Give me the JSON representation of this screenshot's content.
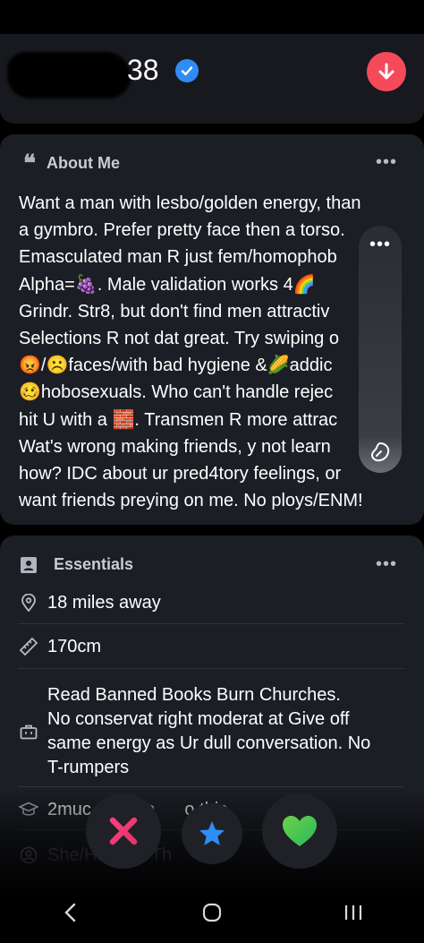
{
  "profile": {
    "age": "38"
  },
  "about": {
    "title": "About Me",
    "more": "•••",
    "lines": [
      "Want a man with lesbo/golden energy, than",
      "a gymbro. Prefer pretty face then a torso.",
      "Emasculated man R just fem/homophob",
      "Alpha=🍇. Male validation works 4🌈",
      "Grindr. Str8, but don't find men attractiv",
      "Selections R not dat great. Try swiping o",
      "😡/☹️faces/with bad hygiene &🌽addic",
      "🥴hobosexuals. Who can't handle rejec",
      "hit U with a 🧱. Transmen R more attrac",
      "Wat's wrong making friends, y not learn",
      "how? IDC about ur pred4tory feelings, or",
      "want friends preying on me. No ploys/ENM!"
    ]
  },
  "overlay": {
    "more": "•••"
  },
  "essentials": {
    "title": "Essentials",
    "more": "•••",
    "distance": "18 miles away",
    "height": "170cm",
    "job_lines": [
      "Read Banned Books Burn Churches.",
      "No conservat right moderat at Give off",
      "same energy as Ur dull conversation. No",
      "T-rumpers"
    ],
    "education": "2muc      nipp      o this",
    "pronouns": "She/H      ey/Th"
  },
  "colors": {
    "background": "#000000",
    "card": "#1b1e24",
    "verified": "#2f8cf5",
    "nope": "#f0436a",
    "super_like": "#2e8ef5",
    "like": "#33c257"
  }
}
